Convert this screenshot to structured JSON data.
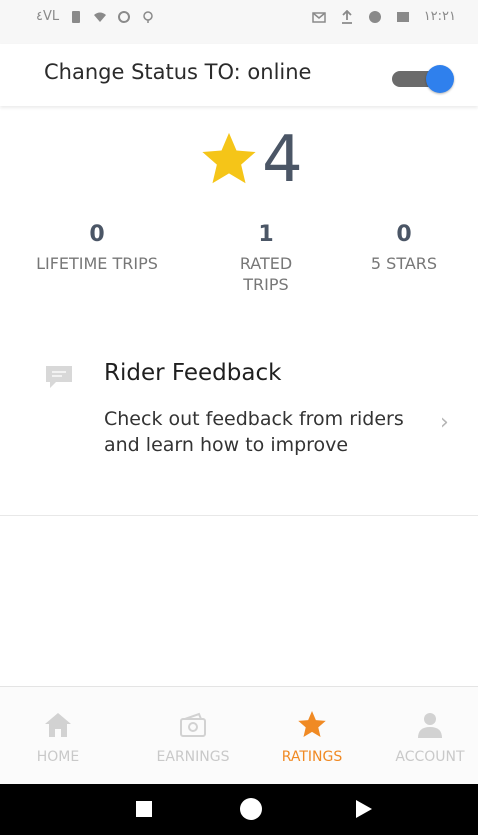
{
  "status_bar": {
    "left_text": "٤VL",
    "time": "١٢:٢١"
  },
  "header": {
    "title": "Change Status TO: online",
    "toggle_on": true,
    "toggle_color": "#2f80ed"
  },
  "rating": {
    "value": "4",
    "star_color": "#f5c518"
  },
  "stats": [
    {
      "value": "0",
      "label": "LIFETIME TRIPS"
    },
    {
      "value": "1",
      "label": "RATED TRIPS"
    },
    {
      "value": "0",
      "label": "5 STARS"
    }
  ],
  "feedback": {
    "title": "Rider Feedback",
    "description": "Check out feedback from riders and learn how to improve",
    "chevron": "›"
  },
  "tabs": [
    {
      "label": "HOME",
      "icon": "home-icon",
      "active": false
    },
    {
      "label": "EARNINGS",
      "icon": "wallet-icon",
      "active": false
    },
    {
      "label": "RATINGS",
      "icon": "star-icon",
      "active": true
    },
    {
      "label": "ACCOUNT",
      "icon": "person-icon",
      "active": false
    }
  ],
  "colors": {
    "active_tab": "#f08a24",
    "inactive_tab": "#c9c9c9"
  }
}
